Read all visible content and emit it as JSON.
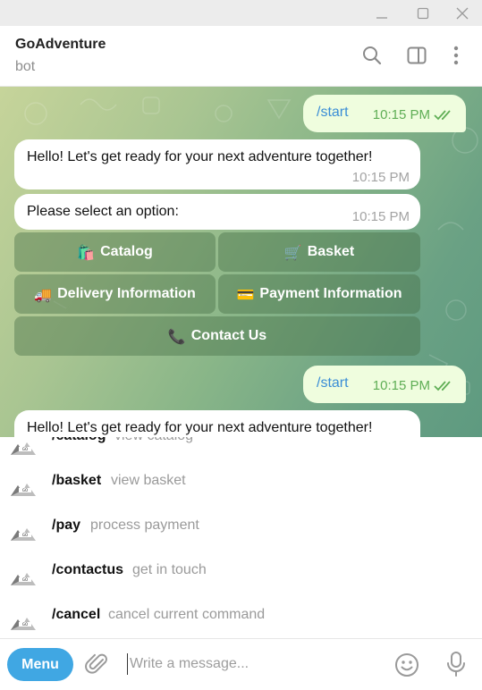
{
  "window": {
    "minimize_icon": "minimize-icon",
    "maximize_icon": "maximize-icon",
    "close_icon": "close-icon"
  },
  "header": {
    "title": "GoAdventure",
    "subtitle": "bot",
    "icons": [
      "search-icon",
      "sidebar-toggle-icon",
      "more-vertical-icon"
    ]
  },
  "messages": {
    "start_cmd_1": "/start",
    "start_time_1": "10:15 PM",
    "greeting_1": "Hello! Let's get ready for your next adventure together!",
    "greeting_time_1": "10:15 PM",
    "select_text": "Please select an option:",
    "select_time": "10:15 PM",
    "start_cmd_2": "/start",
    "start_time_2": "10:15 PM",
    "greeting_2": "Hello! Let's get ready for your next adventure together!"
  },
  "keyboard": {
    "catalog": {
      "emoji": "🛍️",
      "label": "Catalog"
    },
    "basket": {
      "emoji": "🛒",
      "label": "Basket"
    },
    "delivery": {
      "emoji": "🚚",
      "label": "Delivery Information"
    },
    "payment": {
      "emoji": "💳",
      "label": "Payment Information"
    },
    "contact": {
      "emoji": "📞",
      "label": "Contact Us"
    }
  },
  "commands": [
    {
      "name": "/catalog",
      "desc": "view catalog"
    },
    {
      "name": "/basket",
      "desc": "view basket"
    },
    {
      "name": "/pay",
      "desc": "process payment"
    },
    {
      "name": "/contactus",
      "desc": "get in touch"
    },
    {
      "name": "/cancel",
      "desc": "cancel current command"
    }
  ],
  "composer": {
    "menu_label": "Menu",
    "placeholder": "Write a message...",
    "value": ""
  },
  "colors": {
    "accent": "#40a7e3",
    "outgoing_bubble": "#effdde",
    "read_ticks": "#5fae55",
    "command_link": "#3a8dd6"
  }
}
